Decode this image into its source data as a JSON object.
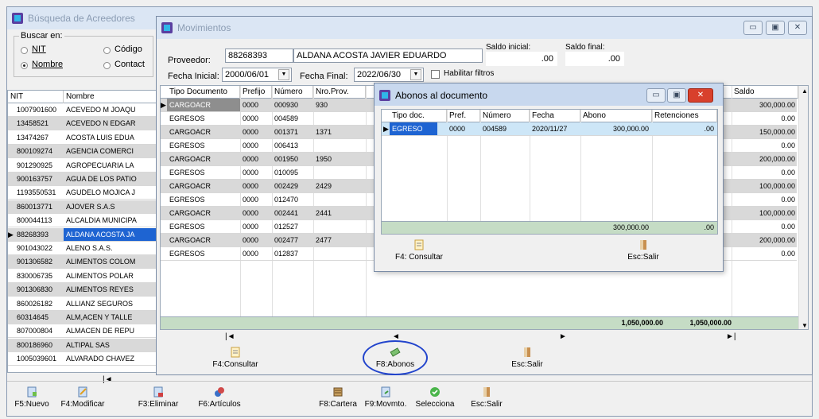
{
  "background_window": {
    "title": "Búsqueda de Acreedores",
    "search_group_label": "Buscar en:",
    "radios": [
      {
        "label": "NIT",
        "checked": false
      },
      {
        "label": "Código",
        "checked": false
      },
      {
        "label": "Nombre",
        "checked": true
      },
      {
        "label": "Contact",
        "checked": false
      }
    ],
    "columns": [
      "NIT",
      "Nombre"
    ],
    "rows": [
      {
        "nit": "1007901600",
        "nombre": "ACEVEDO M JOAQU"
      },
      {
        "nit": "13458521",
        "nombre": "ACEVEDO N EDGAR"
      },
      {
        "nit": "13474267",
        "nombre": "ACOSTA  LUIS EDUA"
      },
      {
        "nit": "800109274",
        "nombre": "AGENCIA COMERCI"
      },
      {
        "nit": "901290925",
        "nombre": "AGROPECUARIA LA"
      },
      {
        "nit": "900163757",
        "nombre": "AGUA DE LOS PATIO"
      },
      {
        "nit": "1193550531",
        "nombre": "AGUDELO MOJICA J"
      },
      {
        "nit": "860013771",
        "nombre": "AJOVER S.A.S"
      },
      {
        "nit": "800044113",
        "nombre": "ALCALDIA MUNICIPA"
      },
      {
        "nit": "88268393",
        "nombre": "ALDANA ACOSTA JA"
      },
      {
        "nit": "901043022",
        "nombre": "ALENO S.A.S."
      },
      {
        "nit": "901306582",
        "nombre": "ALIMENTOS COLOM"
      },
      {
        "nit": "830006735",
        "nombre": "ALIMENTOS POLAR"
      },
      {
        "nit": "901306830",
        "nombre": "ALIMENTOS REYES"
      },
      {
        "nit": "860026182",
        "nombre": "ALLIANZ SEGUROS"
      },
      {
        "nit": "60314645",
        "nombre": "ALM,ACEN Y TALLE"
      },
      {
        "nit": "807000804",
        "nombre": "ALMACEN DE REPU"
      },
      {
        "nit": "800186960",
        "nombre": "ALTIPAL SAS"
      },
      {
        "nit": "1005039601",
        "nombre": "ALVARADO CHAVEZ"
      }
    ],
    "selected_index": 9,
    "nav_first": "|◄",
    "toolbar": [
      {
        "label": "F5:Nuevo",
        "icon": "new-icon"
      },
      {
        "label": "F4:Modificar",
        "icon": "edit-icon"
      },
      {
        "label": "F3:Eliminar",
        "icon": "delete-icon"
      },
      {
        "label": "F6:Artículos",
        "icon": "articles-icon"
      },
      {
        "label": "F8:Cartera",
        "icon": "cartera-icon"
      },
      {
        "label": "F9:Movmto.",
        "icon": "movement-icon"
      },
      {
        "label": "Selecciona",
        "icon": "check-icon"
      },
      {
        "label": "Esc:Salir",
        "icon": "exit-icon"
      }
    ]
  },
  "movimientos": {
    "title": "Movimientos",
    "proveedor_label": "Proveedor:",
    "proveedor_code": "88268393",
    "proveedor_name": "ALDANA ACOSTA JAVIER EDUARDO",
    "saldo_inicial_label": "Saldo inicial:",
    "saldo_inicial_value": ".00",
    "saldo_final_label": "Saldo final:",
    "saldo_final_value": ".00",
    "fecha_inicial_label": "Fecha Inicial:",
    "fecha_inicial_value": "2000/06/01",
    "fecha_final_label": "Fecha Final:",
    "fecha_final_value": "2022/06/30",
    "habilitar_label": "Habilitar filtros",
    "columns": [
      "Tipo Documento",
      "Prefijo",
      "Número",
      "Nro.Prov.",
      "Saldo"
    ],
    "rows": [
      {
        "tipo": "CARGOACR",
        "prefijo": "0000",
        "numero": "000930",
        "prov": "930",
        "saldo": "300,000.00"
      },
      {
        "tipo": "EGRESOS",
        "prefijo": "0000",
        "numero": "004589",
        "prov": "",
        "saldo": "0.00"
      },
      {
        "tipo": "CARGOACR",
        "prefijo": "0000",
        "numero": "001371",
        "prov": "1371",
        "saldo": "150,000.00"
      },
      {
        "tipo": "EGRESOS",
        "prefijo": "0000",
        "numero": "006413",
        "prov": "",
        "saldo": "0.00"
      },
      {
        "tipo": "CARGOACR",
        "prefijo": "0000",
        "numero": "001950",
        "prov": "1950",
        "saldo": "200,000.00"
      },
      {
        "tipo": "EGRESOS",
        "prefijo": "0000",
        "numero": "010095",
        "prov": "",
        "saldo": "0.00"
      },
      {
        "tipo": "CARGOACR",
        "prefijo": "0000",
        "numero": "002429",
        "prov": "2429",
        "saldo": "100,000.00"
      },
      {
        "tipo": "EGRESOS",
        "prefijo": "0000",
        "numero": "012470",
        "prov": "",
        "saldo": "0.00"
      },
      {
        "tipo": "CARGOACR",
        "prefijo": "0000",
        "numero": "002441",
        "prov": "2441",
        "saldo": "100,000.00"
      },
      {
        "tipo": "EGRESOS",
        "prefijo": "0000",
        "numero": "012527",
        "prov": "",
        "saldo": "0.00"
      },
      {
        "tipo": "CARGOACR",
        "prefijo": "0000",
        "numero": "002477",
        "prov": "2477",
        "saldo": "200,000.00"
      },
      {
        "tipo": "EGRESOS",
        "prefijo": "0000",
        "numero": "012837",
        "prov": "",
        "saldo": "0.00"
      }
    ],
    "total_1": "1,050,000.00",
    "total_2": "1,050,000.00",
    "nav": [
      "|◄",
      "◄",
      "►",
      "►|"
    ],
    "buttons": [
      {
        "label": "F4:Consultar",
        "icon": "consult-icon"
      },
      {
        "label": "F8:Abonos",
        "icon": "money-icon"
      },
      {
        "label": "Esc:Salir",
        "icon": "exit-icon"
      }
    ]
  },
  "abonos": {
    "title": "Abonos al documento",
    "columns": [
      "Tipo doc.",
      "Pref.",
      "Número",
      "Fecha",
      "Abono",
      "Retenciones"
    ],
    "rows": [
      {
        "tipo": "EGRESO",
        "pref": "0000",
        "numero": "004589",
        "fecha": "2020/11/27",
        "abono": "300,000.00",
        "ret": ".00"
      }
    ],
    "total_abono": "300,000.00",
    "total_ret": ".00",
    "buttons": [
      {
        "label": "F4: Consultar",
        "icon": "consult-icon"
      },
      {
        "label": "Esc:Salir",
        "icon": "exit-icon"
      }
    ]
  },
  "colors": {
    "selected_blue": "#1e64d2",
    "highlight_circle": "#2244cc",
    "total_green": "#c5dcc5"
  }
}
